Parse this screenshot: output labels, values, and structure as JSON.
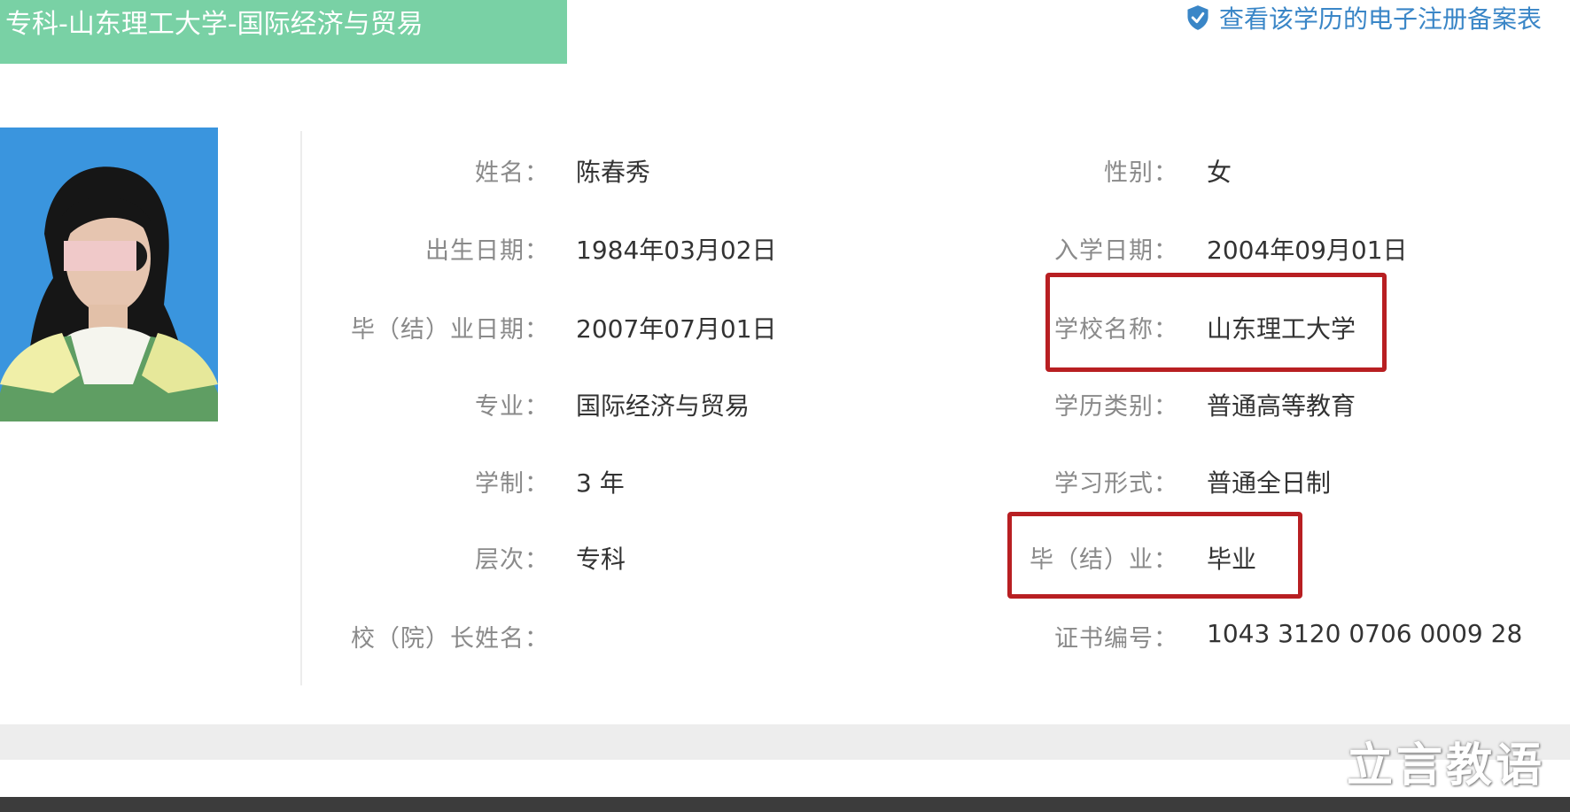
{
  "header": {
    "title": "专科-山东理工大学-国际经济与贸易",
    "registry_link": "查看该学历的电子注册备案表"
  },
  "record": {
    "name": {
      "label": "姓名：",
      "value": "陈春秀"
    },
    "gender": {
      "label": "性别：",
      "value": "女"
    },
    "birth_date": {
      "label": "出生日期：",
      "value": "1984年03月02日"
    },
    "enroll_date": {
      "label": "入学日期：",
      "value": "2004年09月01日"
    },
    "graduation_date": {
      "label": "毕（结）业日期：",
      "value": "2007年07月01日"
    },
    "school_name": {
      "label": "学校名称：",
      "value": "山东理工大学"
    },
    "major": {
      "label": "专业：",
      "value": "国际经济与贸易"
    },
    "education_type": {
      "label": "学历类别：",
      "value": "普通高等教育"
    },
    "duration": {
      "label": "学制：",
      "value": "3 年"
    },
    "study_form": {
      "label": "学习形式：",
      "value": "普通全日制"
    },
    "level": {
      "label": "层次：",
      "value": "专科"
    },
    "graduation_status": {
      "label": "毕（结）业：",
      "value": "毕业"
    },
    "president_name": {
      "label": "校（院）长姓名：",
      "value": ""
    },
    "certificate_number": {
      "label": "证书编号：",
      "value": "1043 3120 0706 0009 28"
    }
  },
  "watermark": {
    "text": "立言教语"
  },
  "colors": {
    "banner": "#79d1a5",
    "link": "#3a86c7",
    "highlight": "#b81f22",
    "label_text": "#8a8a8a",
    "value_text": "#333333"
  },
  "icons": {
    "registry_link": "shield-check-icon"
  }
}
